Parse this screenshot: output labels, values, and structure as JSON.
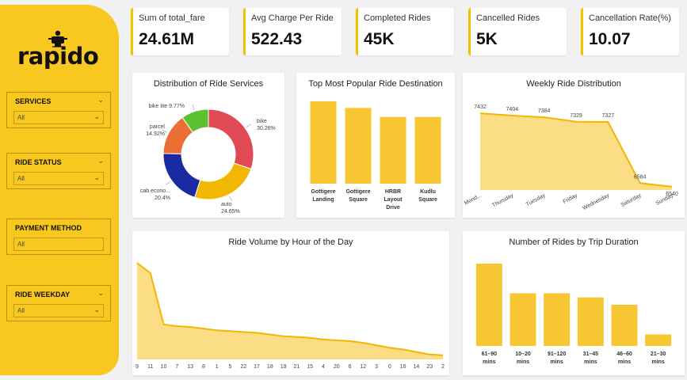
{
  "brand": {
    "logo_text": "rapido",
    "accent": "#f9c820"
  },
  "slicers": [
    {
      "title": "SERVICES",
      "value": "All"
    },
    {
      "title": "RIDE STATUS",
      "value": "All"
    },
    {
      "title": "PAYMENT METHOD",
      "value": "All"
    },
    {
      "title": "RIDE WEEKDAY",
      "value": "All"
    }
  ],
  "kpis": [
    {
      "label": "Sum of total_fare",
      "value": "24.61M"
    },
    {
      "label": "Avg Charge Per Ride",
      "value": "522.43"
    },
    {
      "label": "Completed Rides",
      "value": "45K"
    },
    {
      "label": "Cancelled Rides",
      "value": "5K"
    },
    {
      "label": "Cancellation Rate(%)",
      "value": "10.07"
    }
  ],
  "chart_data": [
    {
      "type": "pie",
      "title": "Distribution of Ride Services",
      "slices": [
        {
          "name": "bike",
          "label": "30.26%",
          "value": 30.26,
          "color": "#e04a55"
        },
        {
          "name": "auto",
          "label": "24.65%",
          "value": 24.65,
          "color": "#f2b700"
        },
        {
          "name": "cab econo...",
          "label": "20.4%",
          "value": 20.4,
          "color": "#1a2aa0"
        },
        {
          "name": "parcel",
          "label": "14.92%",
          "value": 14.92,
          "color": "#eb6e35"
        },
        {
          "name": "bike lite",
          "label": "9.77%",
          "value": 9.77,
          "color": "#5cc12f"
        }
      ]
    },
    {
      "type": "bar",
      "title": "Top Most Popular Ride Destination",
      "categories": [
        [
          "Gottigere",
          "Landing"
        ],
        [
          "Gottigere",
          "Square"
        ],
        [
          "HRBR",
          "Layout",
          "Drive"
        ],
        [
          "Kudlu",
          "Square"
        ]
      ],
      "values": [
        100,
        92,
        81,
        81
      ],
      "color": "#f6c633"
    },
    {
      "type": "area",
      "title": "Weekly Ride Distribution",
      "categories": [
        "Mond...",
        "Thursday",
        "Tuesday",
        "Friday",
        "Wednesday",
        "Saturday",
        "Sunday"
      ],
      "values": [
        7432,
        7404,
        7384,
        7329,
        7327,
        6584,
        6540
      ],
      "labels": [
        "7432",
        "7404",
        "7384",
        "7329",
        "7327",
        "6584",
        "6540"
      ],
      "ylim": [
        6500,
        7500
      ],
      "color": "#f6c633"
    },
    {
      "type": "area",
      "title": "Ride Volume by Hour of the Day",
      "categories": [
        "9",
        "11",
        "10",
        "7",
        "13",
        "8",
        "1",
        "5",
        "22",
        "17",
        "18",
        "19",
        "21",
        "15",
        "4",
        "20",
        "6",
        "12",
        "3",
        "0",
        "16",
        "14",
        "23",
        "2"
      ],
      "values": [
        2180,
        2120,
        1810,
        1800,
        1795,
        1785,
        1775,
        1770,
        1765,
        1760,
        1750,
        1740,
        1735,
        1730,
        1720,
        1715,
        1710,
        1700,
        1685,
        1670,
        1660,
        1645,
        1630,
        1625
      ],
      "color": "#f6c633"
    },
    {
      "type": "bar",
      "title": "Number of Rides by Trip Duration",
      "categories": [
        [
          "61–90",
          "mins"
        ],
        [
          "10–20",
          "mins"
        ],
        [
          "91–120",
          "mins"
        ],
        [
          "31–45",
          "mins"
        ],
        [
          "46–60",
          "mins"
        ],
        [
          "21–30",
          "mins"
        ]
      ],
      "values": [
        100,
        64,
        64,
        59,
        50,
        14
      ],
      "color": "#f6c633"
    }
  ]
}
